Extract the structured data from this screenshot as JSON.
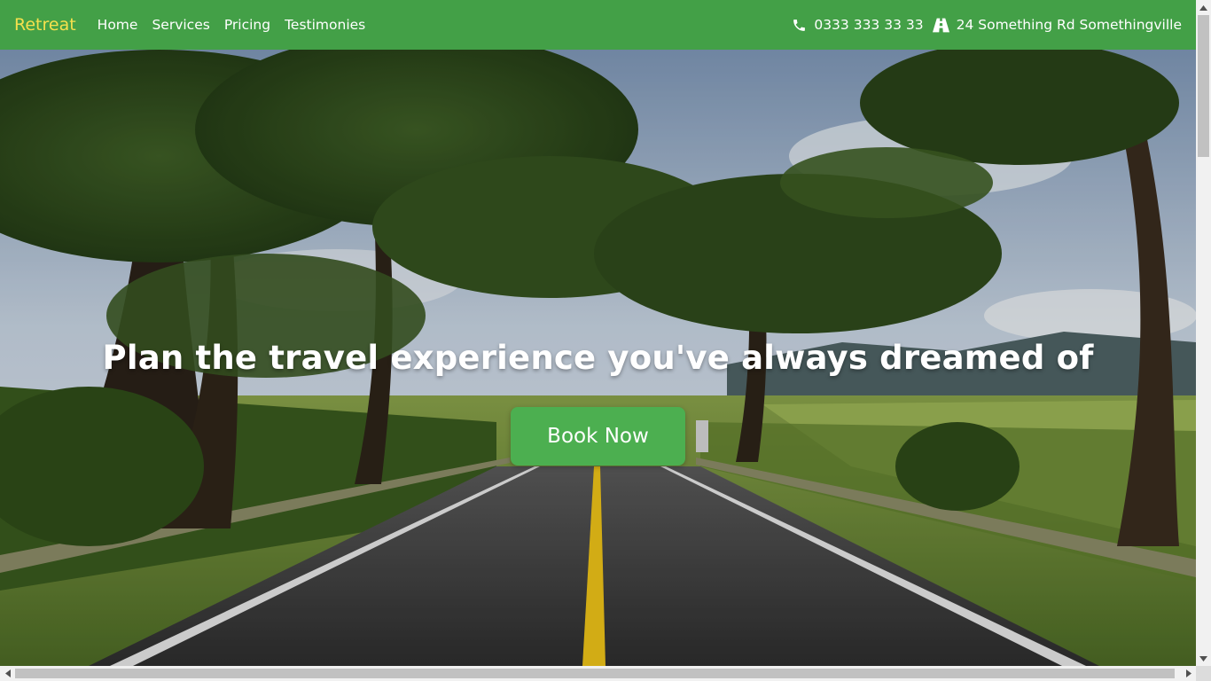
{
  "navbar": {
    "brand": "Retreat",
    "links": [
      {
        "label": "Home"
      },
      {
        "label": "Services"
      },
      {
        "label": "Pricing"
      },
      {
        "label": "Testimonies"
      }
    ],
    "phone": "0333 333 33 33",
    "address": "24 Something Rd Somethingville",
    "phone_icon": "phone-icon",
    "address_icon": "road-icon"
  },
  "hero": {
    "title": "Plan the travel experience you've always dreamed of",
    "cta_label": "Book Now"
  },
  "colors": {
    "navbar_bg": "#43a047",
    "brand": "#f4e04d",
    "button_bg": "#4caf50",
    "text": "#ffffff"
  }
}
